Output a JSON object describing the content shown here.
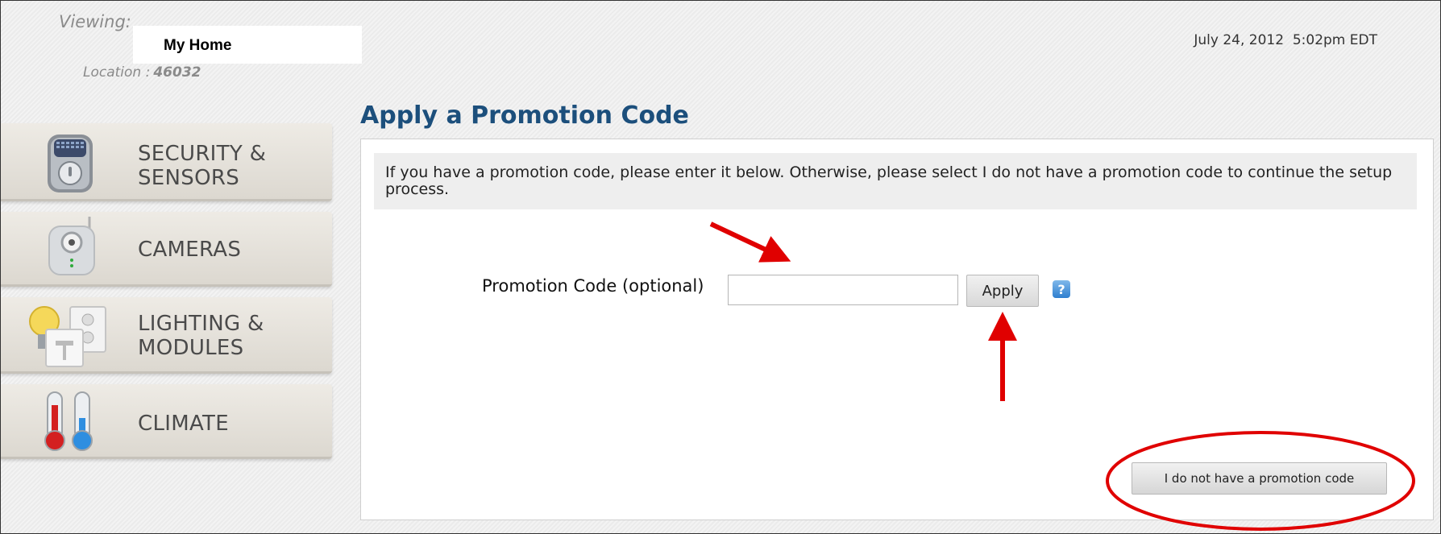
{
  "header": {
    "viewing_label": "Viewing:",
    "home_name": "My Home",
    "location_label": "Location :",
    "location_value": "46032",
    "datetime": "July 24, 2012  5:02pm EDT"
  },
  "page_title": "Apply a Promotion Code",
  "sidebar": {
    "items": [
      {
        "line1": "SECURITY &",
        "line2": "SENSORS",
        "icon": "security-panel-icon"
      },
      {
        "line1": "CAMERAS",
        "line2": "",
        "icon": "camera-icon"
      },
      {
        "line1": "LIGHTING &",
        "line2": "MODULES",
        "icon": "lighting-modules-icon"
      },
      {
        "line1": "CLIMATE",
        "line2": "",
        "icon": "thermometer-icon"
      }
    ]
  },
  "content": {
    "intro_text": "If you have a promotion code, please enter it below. Otherwise, please select I do not have a promotion code to continue the setup process.",
    "promo_label": "Promotion Code (optional)",
    "promo_value": "",
    "apply_label": "Apply",
    "help_glyph": "?",
    "no_promo_label": "I do not have a promotion code"
  },
  "colors": {
    "title": "#1c4f7c",
    "annotation_red": "#e00000",
    "help_blue": "#2f7fcf"
  }
}
